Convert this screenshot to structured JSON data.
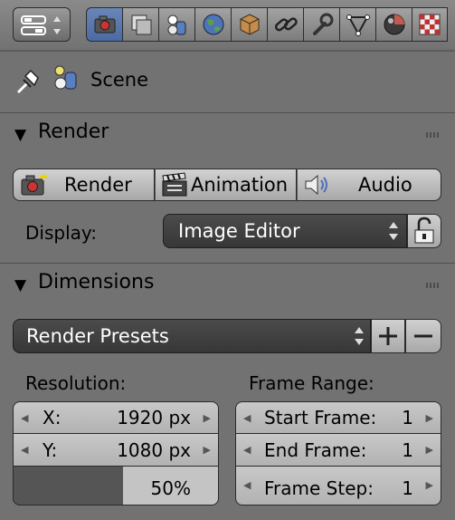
{
  "context": {
    "label": "Scene"
  },
  "header_tabs": [
    "render-tab",
    "render-layers-tab",
    "scene-tab",
    "world-tab",
    "object-tab",
    "constraints-tab",
    "modifiers-tab",
    "data-tab",
    "material-tab",
    "texture-tab"
  ],
  "render": {
    "title": "Render",
    "buttons": {
      "render": "Render",
      "animation": "Animation",
      "audio": "Audio"
    },
    "display_label": "Display:",
    "display_value": "Image Editor"
  },
  "dimensions": {
    "title": "Dimensions",
    "presets": "Render Presets",
    "resolution_label": "Resolution:",
    "x_label": "X:",
    "x_value": "1920 px",
    "y_label": "Y:",
    "y_value": "1080 px",
    "percent": "50%",
    "frame_range_label": "Frame Range:",
    "start_label": "Start Frame:",
    "start_value": "1",
    "end_label": "End Frame:",
    "end_value": "1",
    "step_label": "Frame Step:",
    "step_value": "1"
  }
}
